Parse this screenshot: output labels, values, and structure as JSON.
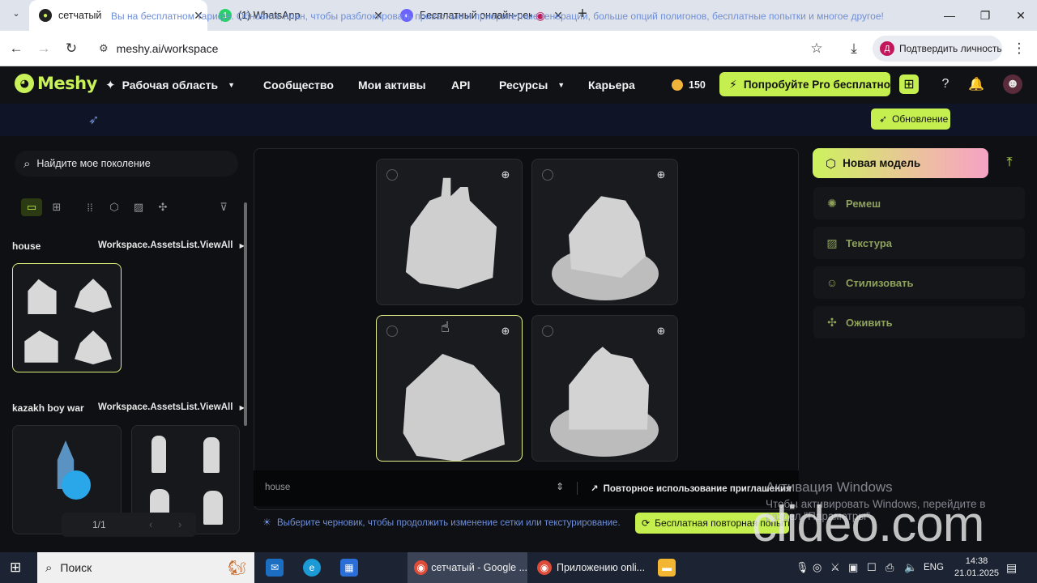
{
  "browser": {
    "tabs": [
      {
        "title": "сетчатый",
        "active": true
      },
      {
        "title": "(1) WhatsApp",
        "active": false
      },
      {
        "title": "Бесплатный онлайн-реко",
        "active": false
      }
    ],
    "new_tab": "+",
    "url": "meshy.ai/workspace",
    "profile_label": "Подтвердить личность",
    "profile_initial": "Д"
  },
  "app": {
    "logo": "Meshy",
    "nav": {
      "workspace": "Рабочая область",
      "community": "Сообщество",
      "assets": "Мои активы",
      "api": "API",
      "resources": "Ресурсы",
      "career": "Карьера"
    },
    "credits": "150",
    "pro_button": "Попробуйте Pro бесплатно"
  },
  "banner": {
    "text": "Вы на бесплатном тарифе. Обновите план, чтобы разблокировать приватные и приоритетные генерации, больше опций полигонов, бесплатные попытки и многое другое!",
    "button": "Обновление"
  },
  "sidebar": {
    "search_placeholder": "Найдите мое поколение",
    "groups": [
      {
        "label": "house",
        "view_all": "Workspace.AssetsList.ViewAll"
      },
      {
        "label": "kazakh boy war",
        "view_all": "Workspace.AssetsList.ViewAll"
      }
    ],
    "pager": "1/1"
  },
  "main": {
    "prompt": "house",
    "reuse_prompt": "Повторное использование приглашения",
    "hint": "Выберите черновик, чтобы продолжить изменение сетки или текстурирование.",
    "retry_button": "Бесплатная повторная попытка"
  },
  "right_panel": {
    "new_model": "Новая модель",
    "tools": [
      "Ремеш",
      "Текстура",
      "Стилизовать",
      "Оживить"
    ]
  },
  "watermarks": {
    "win_title": "Активация Windows",
    "win_line1": "Чтобы активировать Windows, перейдите в",
    "win_line2": "раздел \"Параметры\".",
    "clideo": "clideo.com"
  },
  "taskbar": {
    "search": "Поиск",
    "apps": [
      "сетчатый - Google ...",
      "Приложению onli..."
    ],
    "lang": "ENG",
    "time": "14:38",
    "date": "21.01.2025"
  },
  "colors": {
    "accent": "#c4ef4e",
    "banner_text": "#6f8fd9",
    "background": "#0f1014"
  }
}
